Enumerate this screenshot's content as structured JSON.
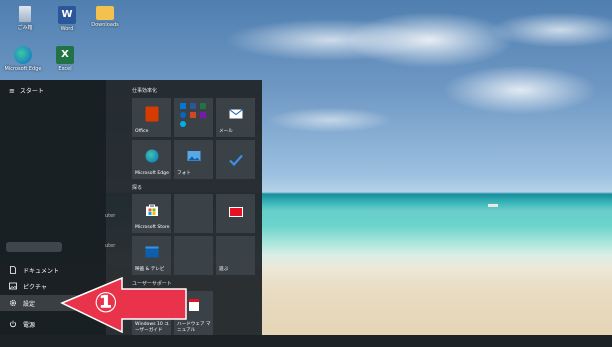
{
  "desktop": {
    "icons": [
      {
        "label": "ごみ箱",
        "icon": "recycle-bin-icon"
      },
      {
        "label": "Word",
        "icon": "word-icon"
      },
      {
        "label": "Downloads",
        "icon": "folder-icon"
      },
      {
        "label": "Microsoft Edge",
        "icon": "edge-icon"
      },
      {
        "label": "Excel",
        "icon": "excel-icon"
      }
    ]
  },
  "start_menu": {
    "header": "スタート",
    "rail_items": [
      {
        "label": "ドキュメント",
        "icon": "document-icon"
      },
      {
        "label": "ピクチャ",
        "icon": "pictures-icon"
      },
      {
        "label": "設定",
        "icon": "gear-icon"
      },
      {
        "label": "電源",
        "icon": "power-icon"
      }
    ],
    "ghost_text": [
      "uter",
      "uter"
    ],
    "groups": [
      {
        "title": "仕事効率化"
      },
      {
        "title": "探る"
      },
      {
        "title": "ユーザーサポート"
      }
    ],
    "tiles": {
      "office": "Office",
      "office_apps": "",
      "mail": "メール",
      "edge": "Microsoft Edge",
      "photos": "フォト",
      "todo": "",
      "store": "Microsoft Store",
      "blank1": "",
      "news": "",
      "movies": "映画 & テレビ",
      "blank2": "",
      "play": "遊ぶ",
      "win10_guide": "Windows 10 ユーザーガイド",
      "hardware_manual": "ハードウェア マニュアル"
    }
  },
  "callout": {
    "number": "①",
    "color": "#e8334a"
  },
  "colors": {
    "accent": "#0078d7",
    "callout": "#e8334a"
  }
}
